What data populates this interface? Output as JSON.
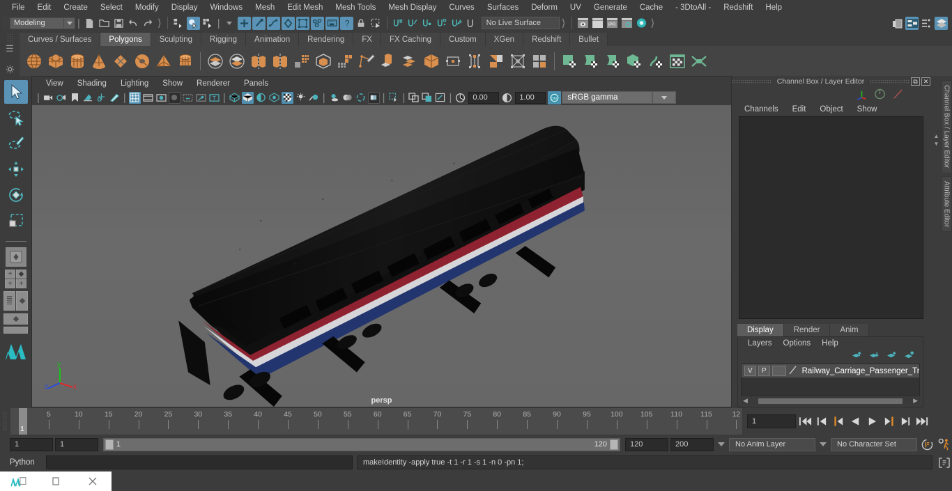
{
  "menubar": {
    "items": [
      "File",
      "Edit",
      "Create",
      "Select",
      "Modify",
      "Display",
      "Windows",
      "Mesh",
      "Edit Mesh",
      "Mesh Tools",
      "Mesh Display",
      "Curves",
      "Surfaces",
      "Deform",
      "UV",
      "Generate",
      "Cache",
      "- 3DtoAll -",
      "Redshift",
      "Help"
    ]
  },
  "statusline": {
    "menuset": "Modeling",
    "live_surface": "No Live Surface"
  },
  "shelf": {
    "tabs": [
      "Curves / Surfaces",
      "Polygons",
      "Sculpting",
      "Rigging",
      "Animation",
      "Rendering",
      "FX",
      "FX Caching",
      "Custom",
      "XGen",
      "Redshift",
      "Bullet"
    ],
    "active_tab": "Polygons"
  },
  "viewport": {
    "menus": [
      "View",
      "Shading",
      "Lighting",
      "Show",
      "Renderer",
      "Panels"
    ],
    "exposure": "0.00",
    "gamma": "1.00",
    "color_profile": "sRGB gamma",
    "camera_label": "persp",
    "axis": {
      "x": "x",
      "y": "y",
      "z": "z"
    }
  },
  "channelbox": {
    "title": "Channel Box / Layer Editor",
    "menus": [
      "Channels",
      "Edit",
      "Object",
      "Show"
    ],
    "side_tabs": [
      "Channel Box / Layer Editor",
      "Attribute Editor"
    ]
  },
  "layereditor": {
    "tabs": [
      "Display",
      "Render",
      "Anim"
    ],
    "active_tab": "Display",
    "menus": [
      "Layers",
      "Options",
      "Help"
    ],
    "layers": [
      {
        "visibility": "V",
        "playback": "P",
        "name": "Railway_Carriage_Passenger_Train_Ca"
      }
    ]
  },
  "timeline": {
    "ticks": [
      5,
      10,
      15,
      20,
      25,
      30,
      35,
      40,
      45,
      50,
      55,
      60,
      65,
      70,
      75,
      80,
      85,
      90,
      95,
      100,
      105,
      110,
      115
    ],
    "last_partial_label": "12",
    "playhead_frame": "1",
    "current_frame": "1"
  },
  "rangebar": {
    "start": "1",
    "start2": "1",
    "range_start": "1",
    "range_end": "120",
    "end": "120",
    "end_total": "200",
    "anim_layer": "No Anim Layer",
    "character_set": "No Character Set"
  },
  "commandline": {
    "language": "Python",
    "input_value": "",
    "output": "makeIdentity -apply true -t 1 -r 1 -s 1 -n 0 -pn 1;"
  },
  "taskbar": {
    "buttons": [
      "maya-icon",
      "minimize",
      "close"
    ]
  }
}
